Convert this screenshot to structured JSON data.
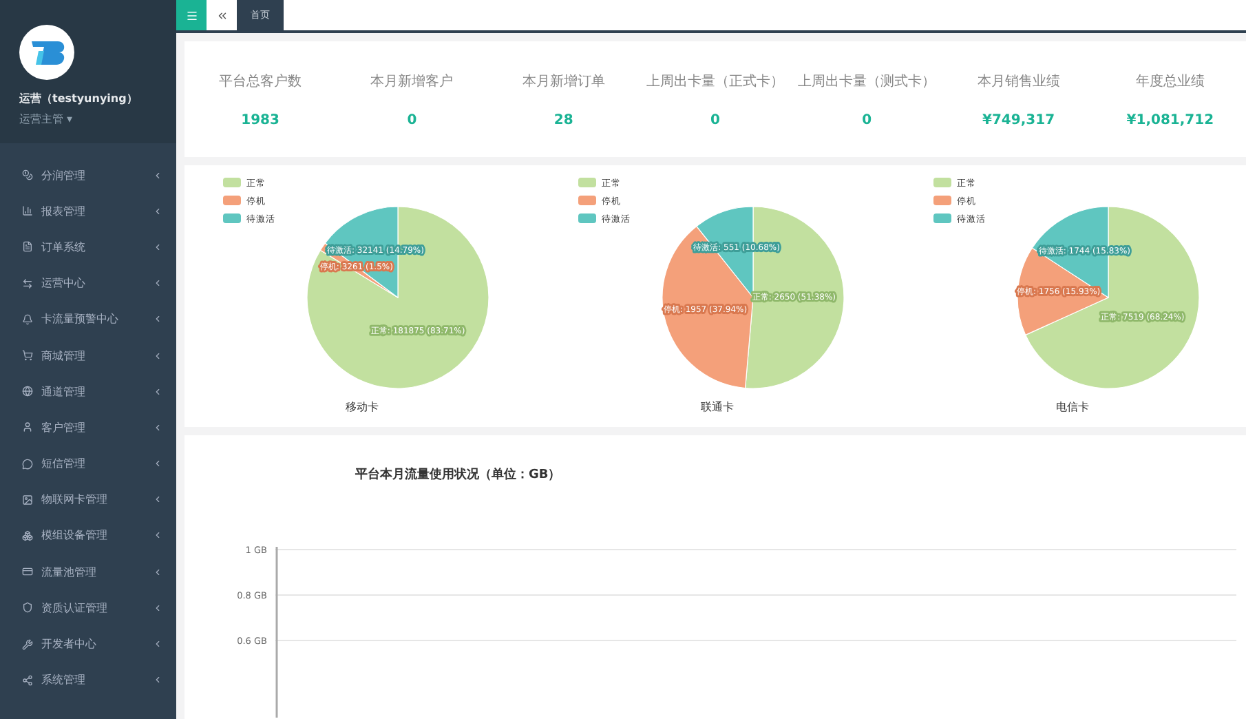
{
  "sidebar": {
    "user": {
      "name": "运营（testyunying）",
      "role": "运营主管",
      "caret": "▾"
    },
    "items": [
      {
        "label": "分润管理"
      },
      {
        "label": "报表管理"
      },
      {
        "label": "订单系统"
      },
      {
        "label": "运营中心"
      },
      {
        "label": "卡流量预警中心"
      },
      {
        "label": "商城管理"
      },
      {
        "label": "通道管理"
      },
      {
        "label": "客户管理"
      },
      {
        "label": "短信管理"
      },
      {
        "label": "物联网卡管理"
      },
      {
        "label": "模组设备管理"
      },
      {
        "label": "流量池管理"
      },
      {
        "label": "资质认证管理"
      },
      {
        "label": "开发者中心"
      },
      {
        "label": "系统管理"
      }
    ]
  },
  "topbar": {
    "tabs": [
      {
        "label": "首页",
        "selected": true
      }
    ]
  },
  "stats": [
    {
      "label": "平台总客户数",
      "value": "1983"
    },
    {
      "label": "本月新增客户",
      "value": "0"
    },
    {
      "label": "本月新增订单",
      "value": "28"
    },
    {
      "label": "上周出卡量（正式卡）",
      "value": "0"
    },
    {
      "label": "上周出卡量（测式卡）",
      "value": "0"
    },
    {
      "label": "本月销售业绩",
      "value": "¥749,317"
    },
    {
      "label": "年度总业绩",
      "value": "¥1,081,712"
    }
  ],
  "pies": [
    {
      "chart_data": {
        "type": "pie",
        "title": "移动卡",
        "legend": "top-left",
        "categories": [
          "正常",
          "停机",
          "待激活"
        ],
        "values": [
          181875,
          3261,
          32141
        ],
        "data_labels": "value_labels",
        "value_labels": [
          "正常: 181875 (83.71%)",
          "停机: 3261 (1.5%)",
          "待激活: 32141 (14.79%)"
        ]
      }
    },
    {
      "chart_data": {
        "type": "pie",
        "title": "联通卡",
        "legend": "top-left",
        "categories": [
          "正常",
          "停机",
          "待激活"
        ],
        "values": [
          2650,
          1957,
          551
        ],
        "data_labels": "value_labels",
        "value_labels": [
          "正常: 2650 (51.38%)",
          "停机: 1957 (37.94%)",
          "待激活: 551 (10.68%)"
        ]
      }
    },
    {
      "chart_data": {
        "type": "pie",
        "title": "电信卡",
        "legend": "top-left",
        "categories": [
          "正常",
          "停机",
          "待激活"
        ],
        "values": [
          7519,
          1756,
          1744
        ],
        "data_labels": "value_labels",
        "value_labels": [
          "正常: 7519 (68.24%)",
          "停机: 1756 (15.93%)",
          "待激活: 1744 (15.83%)"
        ]
      }
    }
  ],
  "traffic": {
    "title": "平台本月流量使用状况（单位：GB）",
    "axis_labels": [
      "1 GB",
      "0.8 GB",
      "0.6 GB"
    ]
  }
}
